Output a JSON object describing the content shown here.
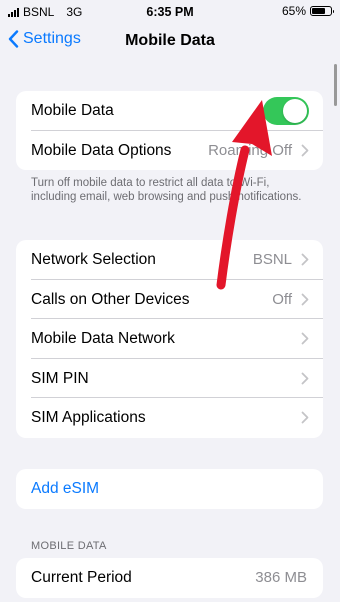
{
  "status_bar": {
    "carrier": "BSNL",
    "network_type": "3G",
    "time": "6:35 PM",
    "battery_percent": "65%",
    "battery_level": 0.65
  },
  "nav": {
    "back_label": "Settings",
    "title": "Mobile Data"
  },
  "group1": {
    "mobile_data_label": "Mobile Data",
    "mobile_data_toggle": "on",
    "options_label": "Mobile Data Options",
    "options_value": "Roaming Off"
  },
  "footer_text": "Turn off mobile data to restrict all data to Wi-Fi, including email, web browsing and push notifications.",
  "group2": {
    "items": [
      {
        "label": "Network Selection",
        "value": "BSNL"
      },
      {
        "label": "Calls on Other Devices",
        "value": "Off"
      },
      {
        "label": "Mobile Data Network",
        "value": ""
      },
      {
        "label": "SIM PIN",
        "value": ""
      },
      {
        "label": "SIM Applications",
        "value": ""
      }
    ]
  },
  "esim": {
    "label": "Add eSIM"
  },
  "section_mobile_data": {
    "header": "MOBILE DATA",
    "current_period_label": "Current Period",
    "current_period_value": "386 MB"
  },
  "colors": {
    "accent": "#0a7aff",
    "toggle_on": "#34c759",
    "annotation_arrow": "#e3162a"
  }
}
